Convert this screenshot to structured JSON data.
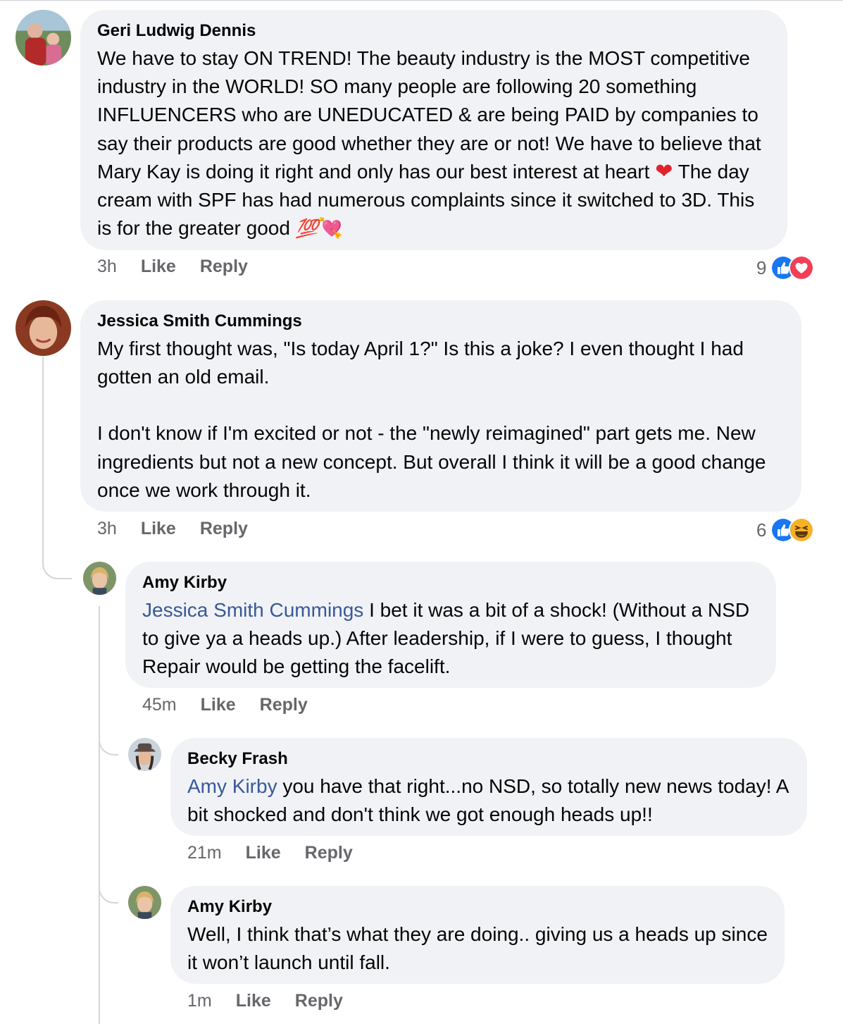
{
  "comments": [
    {
      "author": "Geri Ludwig Dennis",
      "text_parts": [
        "We have to stay ON TREND! The beauty industry is the MOST competitive industry in the WORLD! SO many people are following 20 something INFLUENCERS who are UNEDUCATED & are being PAID by companies to say their products are good whether they are or not! We have to believe that Mary Kay is doing it right and only has our best interest at heart ",
        "❤",
        " The day cream with SPF has had numerous complaints since it switched to 3D. This is for the greater good ",
        "💯",
        "💘"
      ],
      "time": "3h",
      "like": "Like",
      "reply": "Reply",
      "reaction_count": "9",
      "reaction_icons": [
        "like-reaction-icon",
        "love-reaction-icon"
      ]
    },
    {
      "author": "Jessica Smith Cummings",
      "paragraphs": [
        "My first thought was, \"Is today April 1?\" Is this a joke? I even thought I had gotten an old email.",
        "I don't know if I'm excited or not - the \"newly reimagined\" part gets me. New ingredients but not a new concept. But overall I think it will be a good change once we work through it."
      ],
      "time": "3h",
      "like": "Like",
      "reply": "Reply",
      "reaction_count": "6",
      "reaction_icons": [
        "like-reaction-icon",
        "haha-reaction-icon"
      ]
    }
  ],
  "replies": [
    {
      "author": "Amy Kirby",
      "mention": "Jessica Smith Cummings",
      "text": " I bet it was a bit of a shock! (Without a NSD to give ya a heads up.) After leadership, if I were to guess, I thought Repair would be getting the facelift.",
      "time": "45m",
      "like": "Like",
      "reply": "Reply"
    },
    {
      "author": "Becky Frash",
      "mention": "Amy Kirby",
      "text": " you have that right...no NSD, so totally new news today! A bit shocked and don't think we got enough heads up!!",
      "time": "21m",
      "like": "Like",
      "reply": "Reply"
    },
    {
      "author": "Amy Kirby",
      "text": "Well, I think that’s what they are doing.. giving us a heads up since it won’t launch until fall.",
      "time": "1m",
      "like": "Like",
      "reply": "Reply"
    }
  ],
  "colors": {
    "bubble_bg": "#f0f2f5",
    "meta_text": "#65676b",
    "mention": "#385898",
    "like_blue": "#1877f2",
    "love_red": "#f33e58",
    "haha_yellow": "#f7b125"
  }
}
